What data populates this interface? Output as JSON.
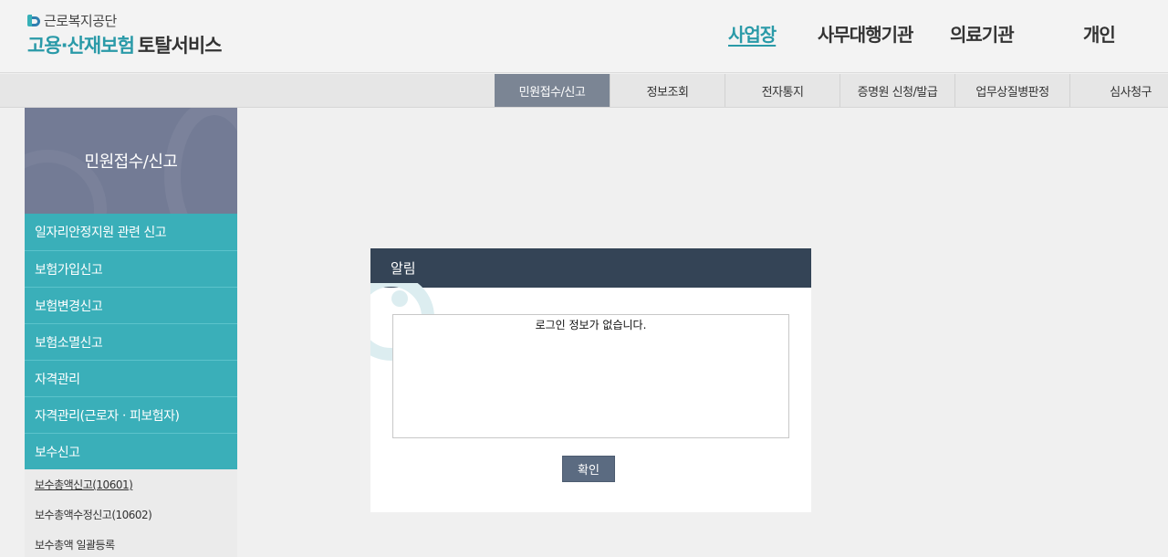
{
  "header": {
    "logo_sub": "근로복지공단",
    "logo_main_teal": "고용·산재보험",
    "logo_main_dark": "토탈서비스",
    "gnb": [
      {
        "label": "사업장",
        "active": true
      },
      {
        "label": "사무대행기관",
        "active": false
      },
      {
        "label": "의료기관",
        "active": false
      },
      {
        "label": "개인",
        "active": false
      }
    ]
  },
  "subnav": [
    {
      "label": "민원접수/신고",
      "active": true
    },
    {
      "label": "정보조회",
      "active": false
    },
    {
      "label": "전자통지",
      "active": false
    },
    {
      "label": "증명원 신청/발급",
      "active": false
    },
    {
      "label": "업무상질병판정",
      "active": false
    },
    {
      "label": "심사청구",
      "active": false
    }
  ],
  "sidebar": {
    "title": "민원접수/신고",
    "menu": [
      "일자리안정지원 관련 신고",
      "보험가입신고",
      "보험변경신고",
      "보험소멸신고",
      "자격관리",
      "자격관리(근로자ㆍ피보험자)",
      "보수신고"
    ],
    "submenu": [
      {
        "label": "보수총액신고(10601)",
        "current": true
      },
      {
        "label": "보수총액수정신고(10602)",
        "current": false
      },
      {
        "label": "보수총액 일괄등록",
        "current": false
      }
    ]
  },
  "modal": {
    "title": "알림",
    "message": "로그인 정보가 없습니다.",
    "ok_label": "확인"
  },
  "colors": {
    "teal": "#3aafb9",
    "sidebar_header": "#737b95",
    "modal_header": "#344456",
    "button": "#5b6b81"
  }
}
